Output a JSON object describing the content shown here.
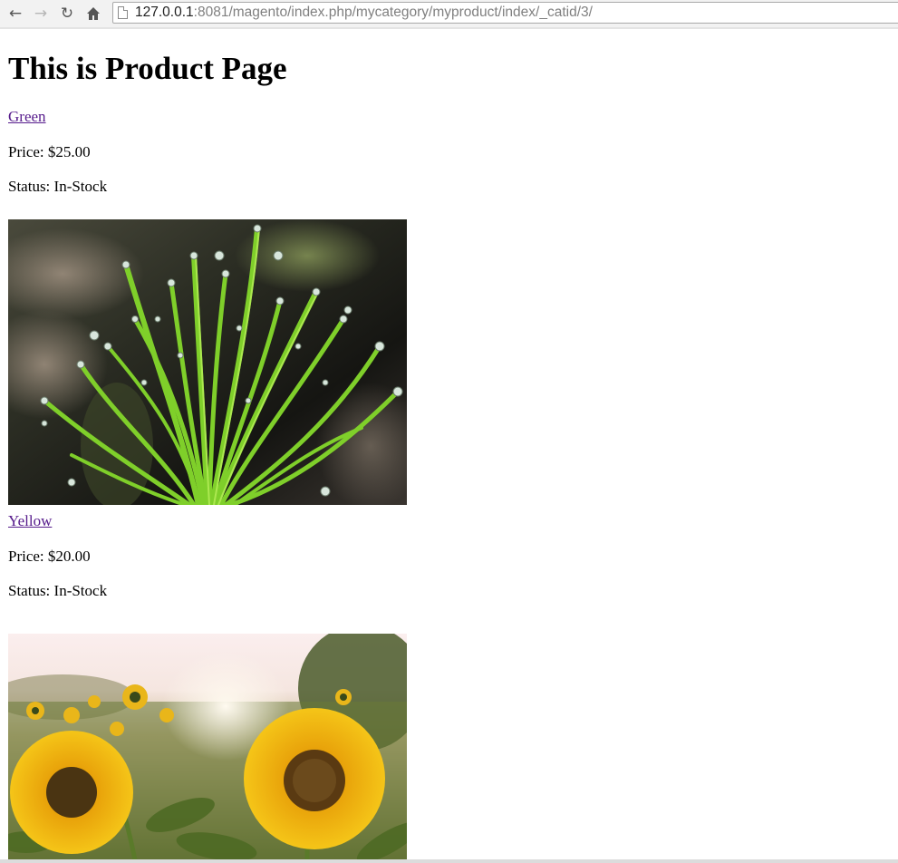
{
  "browser": {
    "url_host": "127.0.0.1",
    "url_path": ":8081/magento/index.php/mycategory/myproduct/index/_catid/3/",
    "icons": [
      "back-arrow-icon",
      "forward-arrow-icon",
      "reload-icon",
      "home-icon",
      "page-icon"
    ]
  },
  "page": {
    "title": "This is Product Page",
    "products": [
      {
        "name": "Green",
        "price_text": "Price: $25.00",
        "status_text": "Status: In-Stock",
        "image": "green-plant-dewdrops-photo"
      },
      {
        "name": "Yellow",
        "price_text": "Price: $20.00",
        "status_text": "Status: In-Stock",
        "image": "sunflowers-field-photo"
      }
    ]
  },
  "colors": {
    "visited_link": "#551a8b",
    "toolbar_bg": "#f2f2f2"
  }
}
